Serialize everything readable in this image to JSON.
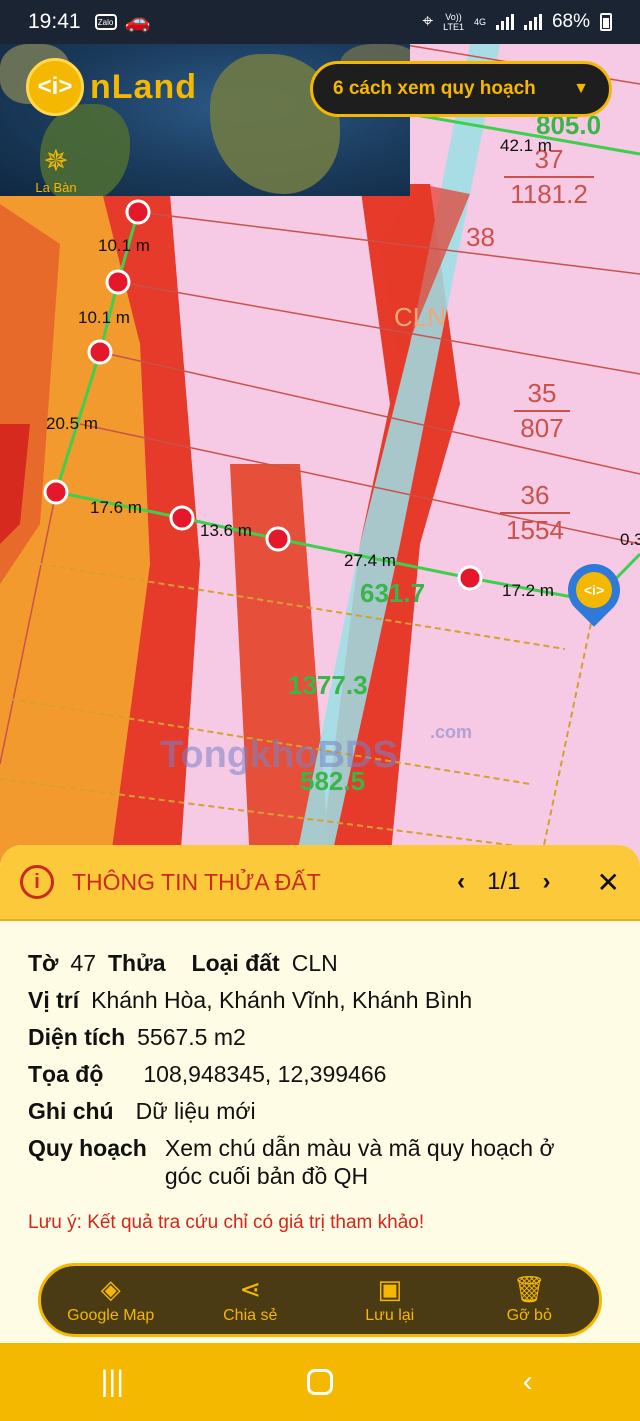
{
  "statusbar": {
    "time": "19:41",
    "app1": "Zalo",
    "network_top": "Vo))",
    "network_bottom": "LTE1",
    "network_type": "4G",
    "battery": "68%"
  },
  "header": {
    "logo_letter": "<i>",
    "app_name": "nLand",
    "compass_label": "La Bàn",
    "view_select": "6 cách xem quy hoạch"
  },
  "map": {
    "measurements": [
      "42.1 m",
      "10.1 m",
      "10.1 m",
      "20.5 m",
      "17.6 m",
      "13.6 m",
      "27.4 m",
      "17.2 m",
      "0.3"
    ],
    "plots": [
      {
        "top": "37",
        "bottom": "1181.2"
      },
      {
        "top": "35",
        "bottom": "807"
      },
      {
        "top": "36",
        "bottom": "1554"
      }
    ],
    "plot_38": "38",
    "cln": "CLN",
    "green_labels": [
      "805.0",
      "631.7",
      "1377.3",
      "582.5"
    ],
    "watermark": "TongkhoBDS",
    "watermark_suffix": ".com"
  },
  "panel": {
    "title": "THÔNG TIN THỬA ĐẤT",
    "pager": "1/1",
    "to_label": "Tờ",
    "to_value": "47",
    "thua_label": "Thửa",
    "loai_label": "Loại đất",
    "loai_value": "CLN",
    "vitri_label": "Vị trí",
    "vitri_value": "Khánh Hòa, Khánh Vĩnh, Khánh Bình",
    "dientich_label": "Diện tích",
    "dientich_value": "5567.5 m2",
    "toado_label": "Tọa độ",
    "toado_value": "108,948345, 12,399466",
    "ghichu_label": "Ghi chú",
    "ghichu_value": "Dữ liệu mới",
    "quyhoach_label": "Quy hoạch",
    "quyhoach_value": "Xem chú dẫn màu và mã quy hoạch ở góc cuối bản đồ QH",
    "warning": "Lưu ý: Kết quả tra cứu chỉ có giá trị tham khảo!",
    "actions": [
      {
        "label": "Google Map",
        "icon": "directions-icon"
      },
      {
        "label": "Chia sẻ",
        "icon": "share-icon"
      },
      {
        "label": "Lưu lại",
        "icon": "save-icon"
      },
      {
        "label": "Gỡ bỏ",
        "icon": "trash-icon"
      }
    ]
  },
  "colors": {
    "accent": "#f5b800",
    "title_red": "#c92b1c",
    "map_pink": "#f6c9e4",
    "map_red": "#e63a2a",
    "map_orange": "#f29a2e"
  }
}
